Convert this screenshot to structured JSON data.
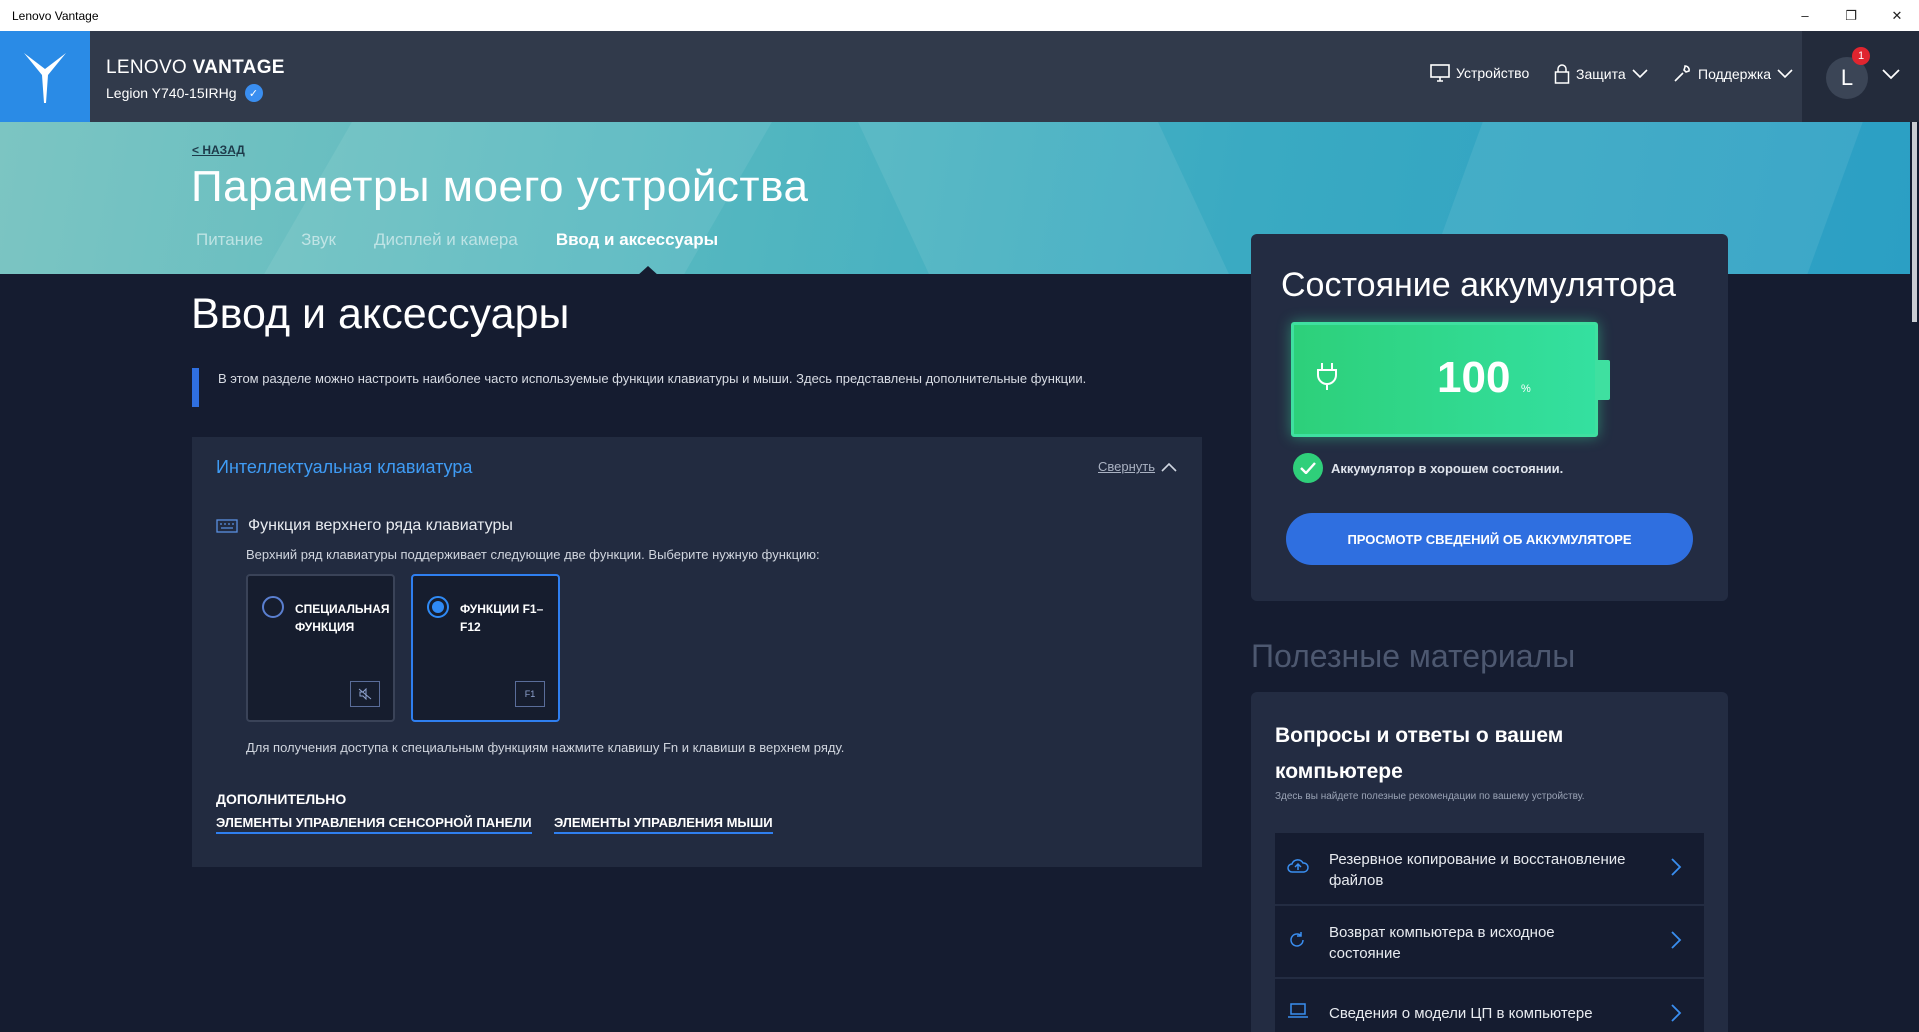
{
  "window": {
    "title": "Lenovo Vantage",
    "min": "–",
    "max": "❐",
    "close": "✕"
  },
  "header": {
    "brand_light": "LENOVO ",
    "brand_bold": "VANTAGE",
    "model": "Legion Y740-15IRHg",
    "nav": {
      "device": "Устройство",
      "protection": "Защита",
      "support": "Поддержка"
    },
    "user_initial": "L",
    "notification_count": "1"
  },
  "banner": {
    "back": "< НАЗАД",
    "title": "Параметры моего устройства",
    "tabs": [
      {
        "label": "Питание",
        "active": false
      },
      {
        "label": "Звук",
        "active": false
      },
      {
        "label": "Дисплей и камера",
        "active": false
      },
      {
        "label": "Ввод и аксессуары",
        "active": true
      }
    ]
  },
  "main": {
    "section_title": "Ввод и аксессуары",
    "info": "В этом разделе можно настроить наиболее часто используемые функции клавиатуры и мыши. Здесь представлены дополнительные функции.",
    "card": {
      "title": "Интеллектуальная клавиатура",
      "collapse": "Свернуть",
      "feature_title": "Функция верхнего ряда клавиатуры",
      "feature_desc": "Верхний ряд клавиатуры поддерживает следующие две функции. Выберите нужную функцию:",
      "options": [
        {
          "label": "СПЕЦИАЛЬНАЯ ФУНКЦИЯ",
          "selected": false,
          "icon": "mute-key-icon"
        },
        {
          "label": "ФУНКЦИИ F1–F12",
          "selected": true,
          "icon": "f1-key-icon",
          "icon_text": "F1"
        }
      ],
      "hint": "Для получения доступа к специальным функциям нажмите клавишу Fn и клавиши в верхнем ряду.",
      "extra_head": "ДОПОЛНИТЕЛЬНО",
      "links": [
        "ЭЛЕМЕНТЫ УПРАВЛЕНИЯ СЕНСОРНОЙ ПАНЕЛИ",
        "ЭЛЕМЕНТЫ УПРАВЛЕНИЯ МЫШИ"
      ]
    }
  },
  "battery": {
    "title": "Состояние аккумулятора",
    "percent": "100",
    "percent_unit": "%",
    "level": 1.0,
    "status": "Аккумулятор в хорошем состоянии.",
    "button": "ПРОСМОТР СВЕДЕНИЙ ОБ АККУМУЛЯТОРЕ"
  },
  "useful": {
    "title": "Полезные материалы",
    "faq_title": "Вопросы и ответы о вашем компьютере",
    "faq_sub": "Здесь вы найдете полезные рекомендации по вашему устройству.",
    "items": [
      {
        "label": "Резервное копирование и восстановление файлов",
        "icon": "cloud-upload-icon"
      },
      {
        "label": "Возврат компьютера в исходное состояние",
        "icon": "refresh-icon"
      },
      {
        "label": "Сведения о модели ЦП в компьютере",
        "icon": "laptop-icon"
      }
    ]
  },
  "colors": {
    "accent": "#2f6fe0",
    "link_blue": "#3f9cf5",
    "battery_green": "#2dd07a",
    "background": "#151c30"
  }
}
